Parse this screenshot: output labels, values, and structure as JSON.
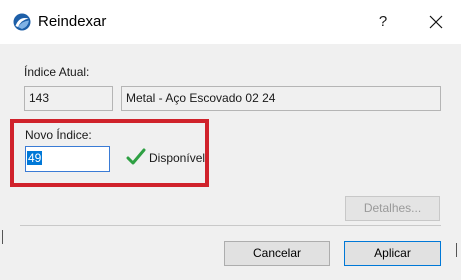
{
  "window": {
    "title": "Reindexar",
    "help_label": "?"
  },
  "current_index": {
    "label": "Índice Atual:",
    "number": "143",
    "name": "Metal - Aço Escovado 02 24"
  },
  "new_index": {
    "label": "Novo Índice:",
    "value": "49",
    "status": "Disponível"
  },
  "buttons": {
    "details": "Detalhes...",
    "cancel": "Cancelar",
    "apply": "Aplicar"
  },
  "colors": {
    "highlight_frame": "#d0222b",
    "check": "#2ea043",
    "selection": "#0078d7"
  },
  "icons": {
    "app": "archicad-icon",
    "status": "checkmark-icon",
    "close": "close-icon"
  }
}
